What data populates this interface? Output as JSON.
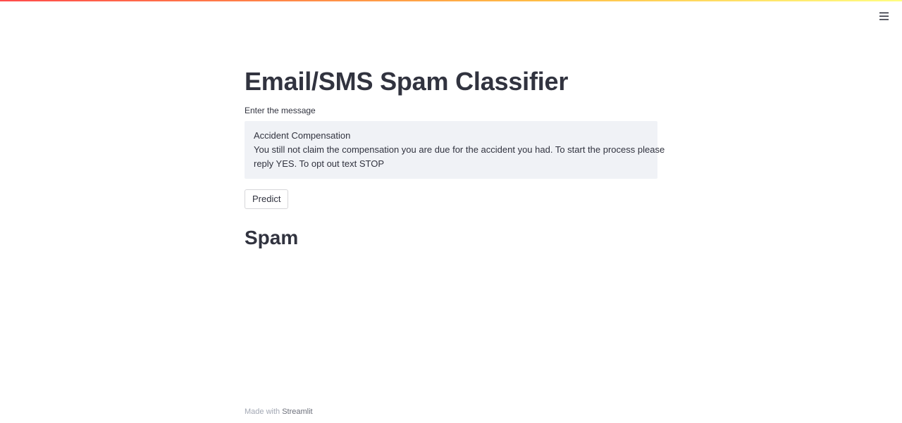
{
  "header": {
    "menu_icon": "hamburger-menu-icon",
    "decoration_colors": [
      "#ff4b4b",
      "#ffbd45",
      "#fffd80"
    ]
  },
  "main": {
    "title": "Email/SMS Spam Classifier",
    "input_label": "Enter the message",
    "message_lines": [
      "Accident Compensation",
      "You still not claim the compensation you are due for the accident you had. To start the process please",
      "reply YES. To opt out text STOP"
    ],
    "predict_label": "Predict",
    "result": "Spam"
  },
  "footer": {
    "made_with": "Made with",
    "brand": "Streamlit"
  }
}
